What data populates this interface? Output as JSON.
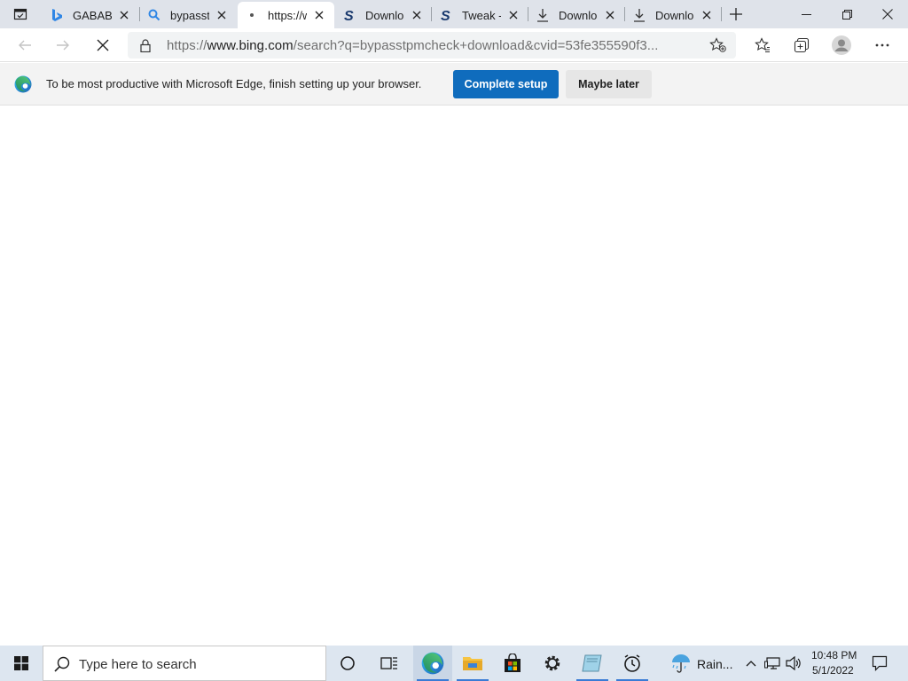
{
  "browser": {
    "tab_actions_icon": "tab-actions-icon",
    "tabs": [
      {
        "title": "GABABA",
        "icon": "bing-icon",
        "active": false
      },
      {
        "title": "bypasstpmcheck",
        "icon": "search-icon",
        "active": false
      },
      {
        "title": "https://www",
        "icon": "loading-dot-icon",
        "active": true
      },
      {
        "title": "Download",
        "icon": "s-logo-icon",
        "active": false
      },
      {
        "title": "Tweak -",
        "icon": "s-logo-icon",
        "active": false
      },
      {
        "title": "Download",
        "icon": "download-icon",
        "active": false
      },
      {
        "title": "Download",
        "icon": "download-icon",
        "active": false
      }
    ],
    "address_bar": {
      "url_scheme": "https://",
      "url_host": "www.bing.com",
      "url_rest": "/search?q=bypasstpmcheck+download&cvid=53fe355590f3..."
    }
  },
  "infobar": {
    "message": "To be most productive with Microsoft Edge, finish setting up your browser.",
    "primary_button": "Complete setup",
    "secondary_button": "Maybe later"
  },
  "taskbar": {
    "search_placeholder": "Type here to search",
    "weather_text": "Rain...",
    "time": "10:48 PM",
    "date": "5/1/2022"
  },
  "colors": {
    "accent": "#0f6cbd",
    "tabstrip_bg": "#dfe3ea",
    "taskbar_bg": "#dde6f0"
  }
}
